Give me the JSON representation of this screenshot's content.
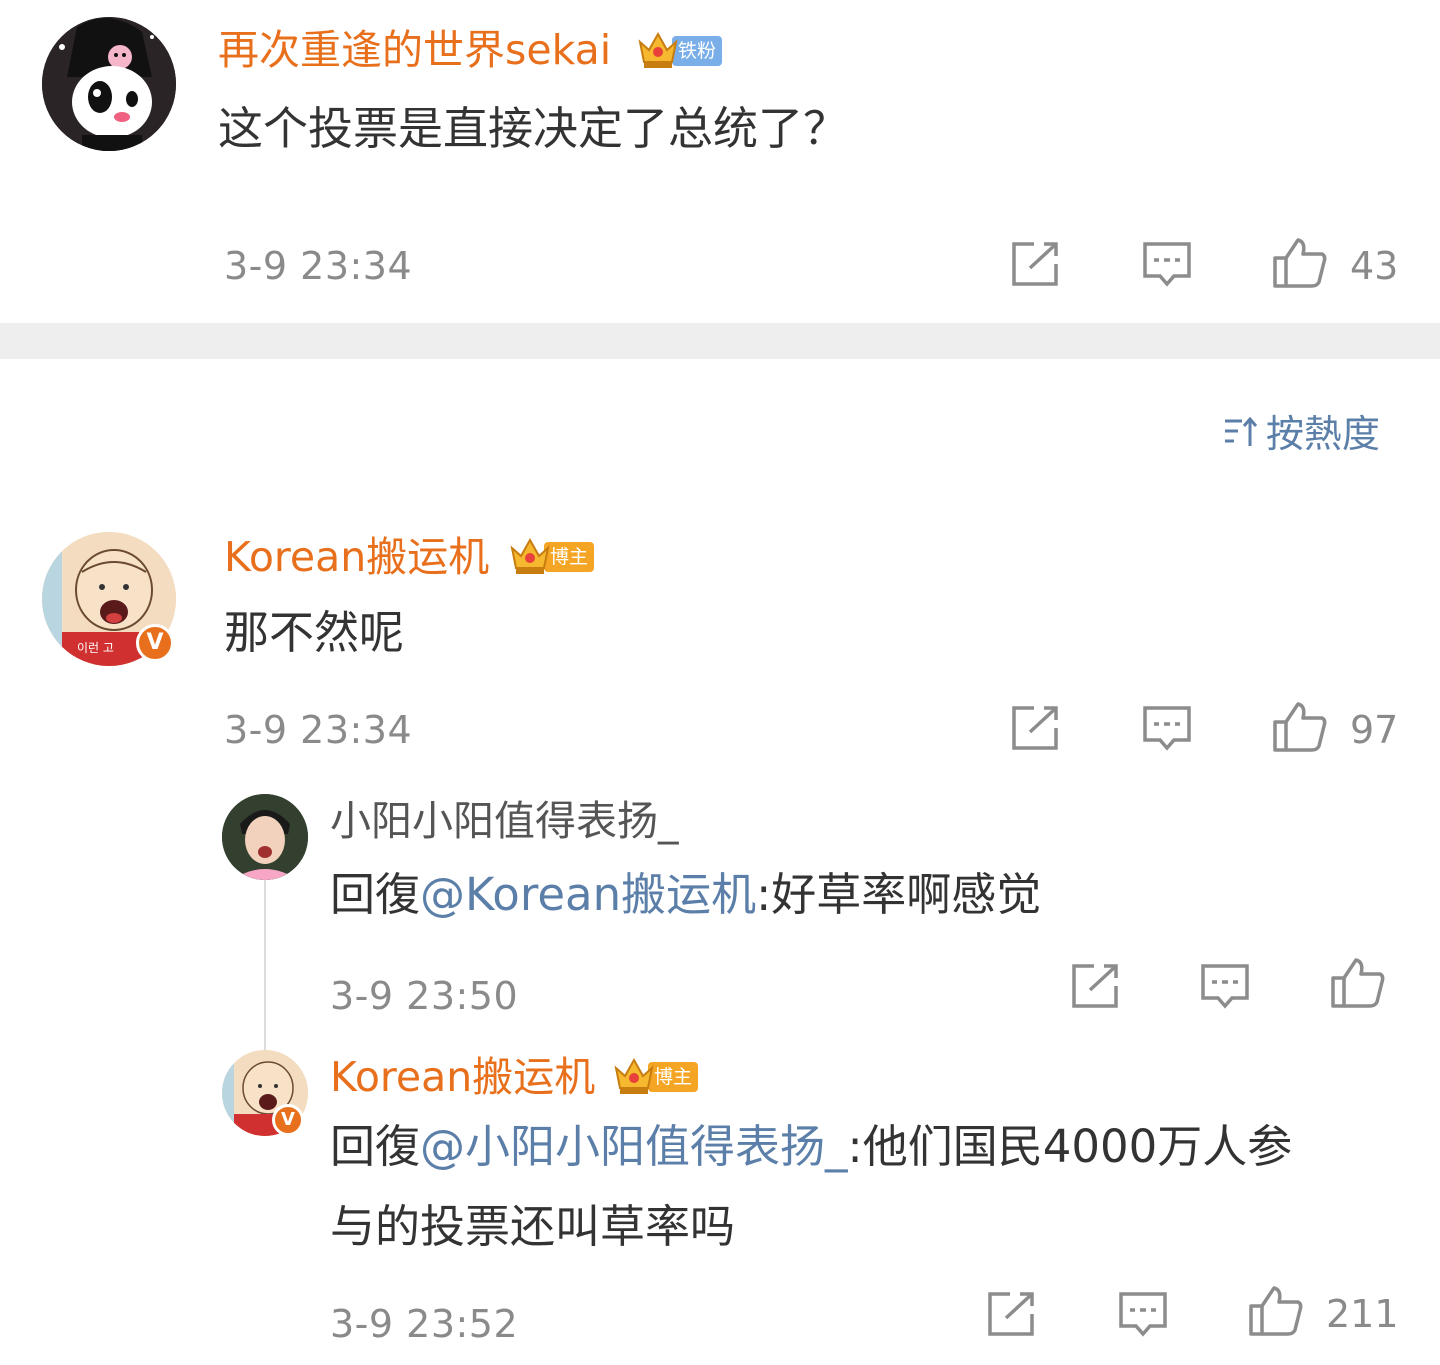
{
  "colors": {
    "username": "#e8701c",
    "link": "#5b7fa8",
    "timestamp": "#8a8a8a",
    "badge_tiefen": "#7aaee8",
    "badge_bozhu": "#f5a524"
  },
  "comment1": {
    "username": "再次重逢的世界sekai",
    "badge": "铁粉",
    "text": "这个投票是直接决定了总统了？",
    "timestamp": "3-9 23:34",
    "likes": "43"
  },
  "sort": {
    "icon": "sort-icon",
    "label": "按熱度"
  },
  "comment2": {
    "username": "Korean搬运机",
    "badge": "博主",
    "verified": "V",
    "text": "那不然呢",
    "timestamp": "3-9 23:34",
    "likes": "97"
  },
  "reply1": {
    "username": "小阳小阳值得表扬_",
    "prefix": "回復",
    "mention": "@Korean搬运机",
    "text": ":好草率啊感觉",
    "timestamp": "3-9 23:50"
  },
  "reply2": {
    "username": "Korean搬运机",
    "badge": "博主",
    "verified": "V",
    "prefix": "回復",
    "mention": "@小阳小阳值得表扬_",
    "text_line1": ":他们国民4000万人参",
    "text_line2": "与的投票还叫草率吗",
    "timestamp": "3-9 23:52",
    "likes": "211"
  }
}
